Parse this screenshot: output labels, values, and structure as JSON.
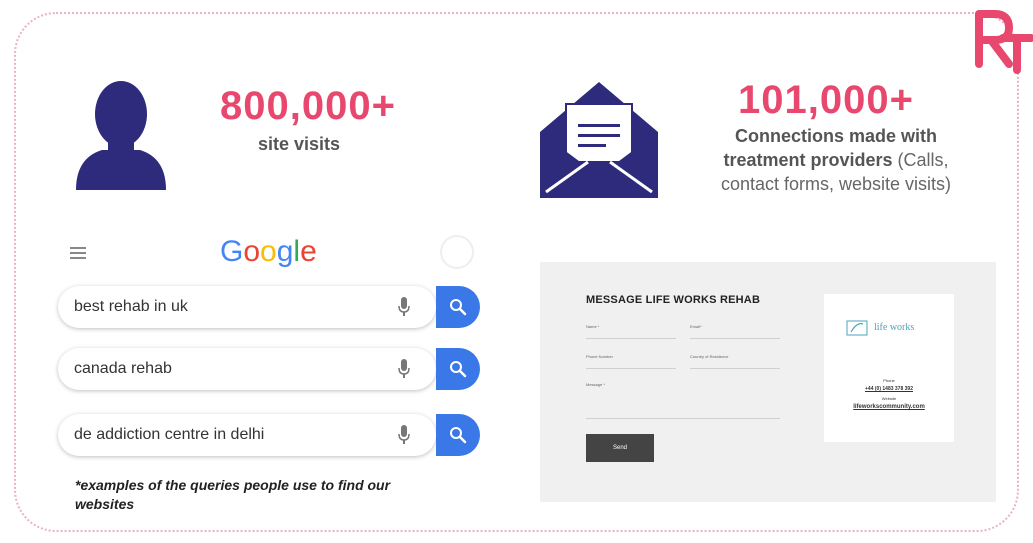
{
  "brand": {
    "logo_text": "RT"
  },
  "stats": {
    "visits": {
      "number": "800,000+",
      "label": "site visits"
    },
    "connections": {
      "number": "101,000+",
      "label_bold_1": "Connections made with",
      "label_bold_2": "treatment providers",
      "label_light_1": " (Calls,",
      "label_light_2": "contact forms, website visits)"
    }
  },
  "google": {
    "logo_letters": [
      "G",
      "o",
      "o",
      "g",
      "l",
      "e"
    ],
    "logo_colors": [
      "#4285F4",
      "#EA4335",
      "#FBBC05",
      "#4285F4",
      "#34A853",
      "#EA4335"
    ],
    "queries": [
      "best rehab in uk",
      "canada rehab",
      "de addiction centre in delhi"
    ]
  },
  "note": "*examples of the queries people use to find our websites",
  "form": {
    "title": "MESSAGE LIFE WORKS REHAB",
    "fields": {
      "name": "Name *",
      "email": "Email*",
      "phone": "Phone Number",
      "country": "Country of Residence",
      "message": "Message *"
    },
    "send_label": "Send",
    "card": {
      "logo_text": "life works",
      "phone_label": "Phone",
      "phone": "+44 (0) 1483 378 392",
      "website_label": "Website",
      "website": "lifeworkscommunity.com"
    }
  },
  "colors": {
    "accent": "#e8476e",
    "icon_navy": "#2e2a7c",
    "search_blue": "#3b78e7"
  }
}
